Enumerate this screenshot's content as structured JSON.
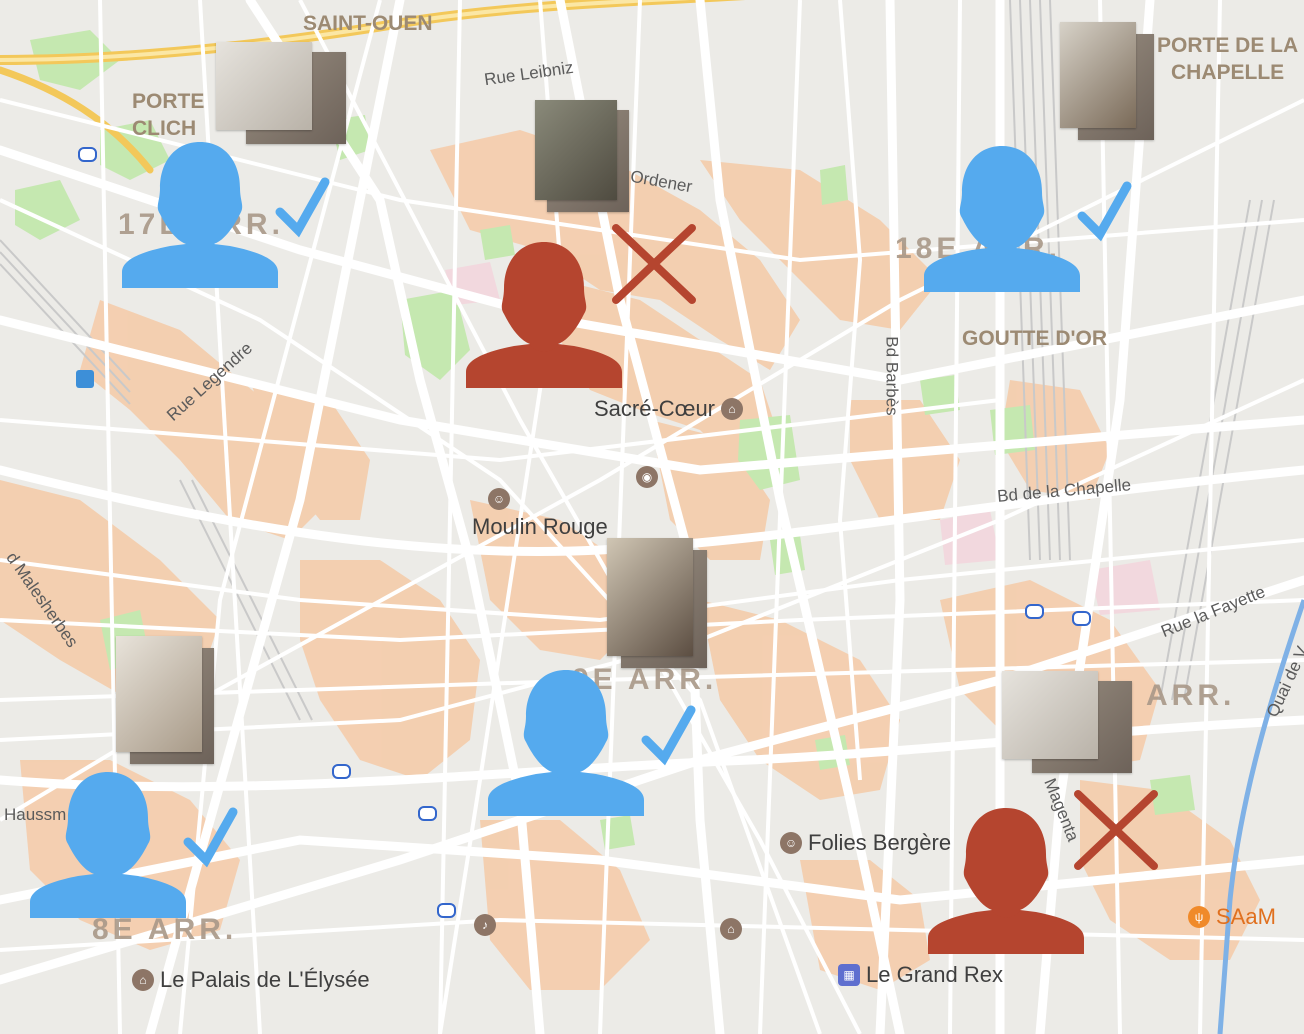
{
  "labels": {
    "saint_ouen": "SAINT-OUEN",
    "porte_clichy": "PORTE\nCLICH",
    "arr17": "17E ARR.",
    "arr18": "18E ARR.",
    "arr9": "9E ARR.",
    "arr8": "8E ARR.",
    "arr10": "ARR.",
    "porte_chapelle": "PORTE DE LA\nCHAPELLE",
    "goutte_dor": "GOUTTE D'OR",
    "rue_leibniz": "Rue Leibniz",
    "ordener": "Ordener",
    "bd_barbes": "Bd Barbès",
    "rue_legendre": "Rue Legendre",
    "bd_chapelle": "Bd de la Chapelle",
    "malesherbes": "d Malesherbes",
    "rue_lafayette": "Rue la Fayette",
    "quai": "Quai de V",
    "haussm": "Haussm",
    "magenta": "Magenta"
  },
  "pois": {
    "sacre_coeur": "Sacré-Cœur",
    "moulin_rouge": "Moulin Rouge",
    "folies": "Folies Bergère",
    "elysee": "Le Palais de L'Élysée",
    "grand_rex": "Le Grand Rex",
    "saam": "SAaM"
  },
  "markers": [
    {
      "status": "approved",
      "status_icon": "check-icon",
      "color": "#55aaee"
    },
    {
      "status": "rejected",
      "status_icon": "cross-icon",
      "color": "#b5452f"
    },
    {
      "status": "approved",
      "status_icon": "check-icon",
      "color": "#55aaee"
    },
    {
      "status": "approved",
      "status_icon": "check-icon",
      "color": "#55aaee"
    },
    {
      "status": "approved",
      "status_icon": "check-icon",
      "color": "#55aaee"
    },
    {
      "status": "rejected",
      "status_icon": "cross-icon",
      "color": "#b5452f"
    }
  ],
  "colors": {
    "approved": "#55aaee",
    "rejected": "#b5452f",
    "map_bg": "#ecebe7",
    "built_area": "#f4ceae",
    "park": "#c5e8b0",
    "road": "#ffffff",
    "highway": "#f7d774"
  }
}
